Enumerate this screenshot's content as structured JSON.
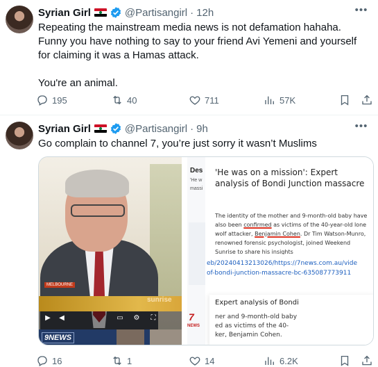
{
  "tweets": [
    {
      "name": "Syrian Girl",
      "handle": "@Partisangirl",
      "separator": "·",
      "time": "12h",
      "text": "Repeating the mainstream media news is not defamation hahaha. Funny you have nothing to say to your friend Avi Yemeni and yourself for claiming it was a Hamas attack.\n\nYou're an animal.",
      "stats": {
        "replies": "195",
        "reposts": "40",
        "likes": "711",
        "views": "57K"
      }
    },
    {
      "name": "Syrian Girl",
      "handle": "@Partisangirl",
      "separator": "·",
      "time": "9h",
      "text": "Go complain to channel 7, you’re just sorry it wasn’t Muslims",
      "stats": {
        "replies": "16",
        "reposts": "1",
        "likes": "14",
        "views": "6.2K"
      },
      "media": {
        "video": {
          "location_tag": "MELBOURNE",
          "channel_bug": "sunrise",
          "banner_logo": "9NEWS"
        },
        "article": {
          "side_heading": "Des",
          "side_snippets": [
            "'He w",
            "massi"
          ],
          "title": "'He was on a mission': Expert analysis of Bondi Junction massacre",
          "body_part1": "The identity of the mother and 9-month-old baby have also been ",
          "body_confirmed": "confirmed",
          "body_part2": " as victims of the 40-year-old lone wolf attacker, ",
          "body_name": "Benjamin Cohen",
          "body_part3": ". Dr Tim Watson-Munro, renowned forensic psychologist, joined Weekend Sunrise to share his insights",
          "url_line1": "eb/20240413213026/https://7news.com.au/vide",
          "url_line2": "of-bondi-junction-massacre-bc-635087773911",
          "snippet_title": "Expert analysis of Bondi",
          "snippet_text": "ner and 9-month-old baby\ned as victims of the 40-\nker, Benjamin Cohen.",
          "logo": "7",
          "logo_sub": "NEWS"
        }
      }
    }
  ],
  "colors": {
    "text": "#0f1419",
    "muted": "#536471",
    "verified": "#1d9bf0",
    "border": "#cfd9de"
  },
  "icons": [
    "more-icon",
    "reply-icon",
    "retweet-icon",
    "like-icon",
    "views-icon",
    "bookmark-icon",
    "share-icon",
    "verified-badge-icon",
    "egypt-flag-icon"
  ]
}
